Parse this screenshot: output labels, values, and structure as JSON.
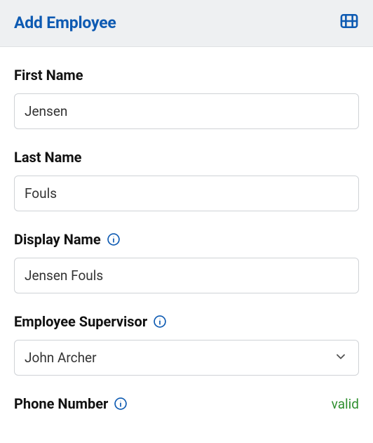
{
  "header": {
    "title": "Add Employee",
    "icon": "video-icon"
  },
  "fields": {
    "first_name": {
      "label": "First Name",
      "value": "Jensen"
    },
    "last_name": {
      "label": "Last Name",
      "value": "Fouls"
    },
    "display_name": {
      "label": "Display Name",
      "value": "Jensen Fouls"
    },
    "supervisor": {
      "label": "Employee Supervisor",
      "value": "John Archer"
    },
    "phone": {
      "label": "Phone Number",
      "status": "valid"
    }
  },
  "colors": {
    "primary": "#0d5ab2",
    "header_bg": "#eef0f2",
    "border": "#cfd2d6",
    "status_valid": "#2f8f2f"
  }
}
